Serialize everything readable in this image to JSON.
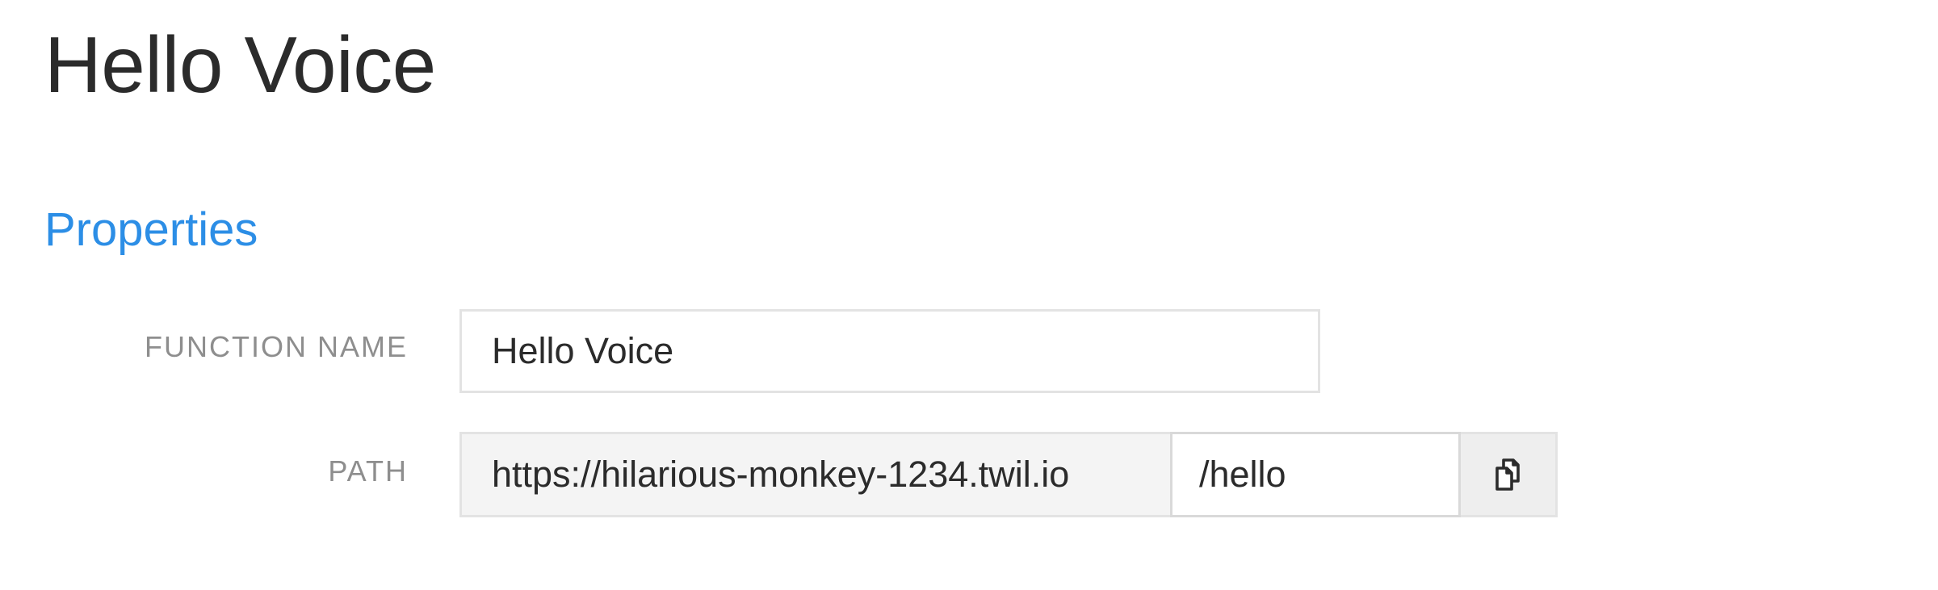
{
  "page": {
    "title": "Hello Voice"
  },
  "properties": {
    "section_title": "Properties",
    "function_name": {
      "label": "FUNCTION NAME",
      "value": "Hello Voice"
    },
    "path": {
      "label": "PATH",
      "prefix": "https://hilarious-monkey-1234.twil.io",
      "value": "/hello",
      "copy_icon": "copy-icon"
    }
  },
  "colors": {
    "accent": "#2c8ee6",
    "label": "#8e8e8e",
    "text": "#2b2b2b",
    "border": "#e3e3e3",
    "prefix_bg": "#f4f4f4"
  }
}
